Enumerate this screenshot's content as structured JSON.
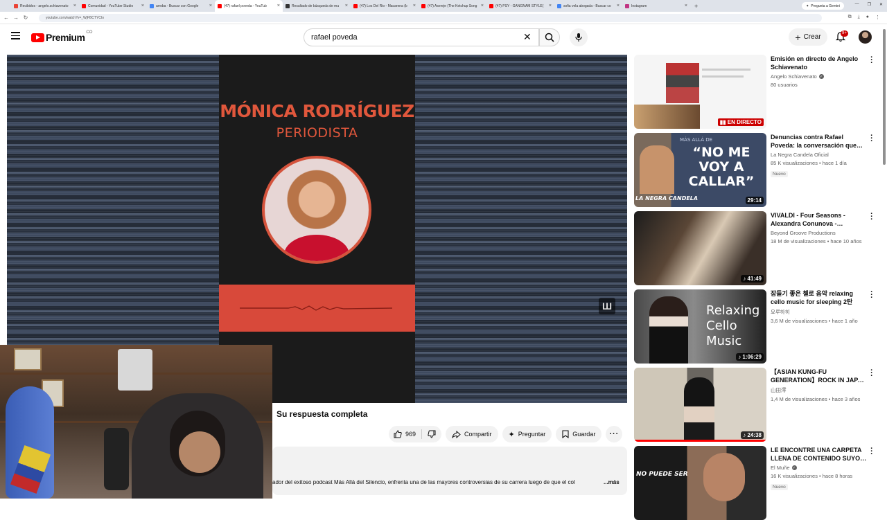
{
  "browser": {
    "tabs": [
      {
        "title": "Recibidos - angelo.schiavenato",
        "color": "#ea4335"
      },
      {
        "title": "Comunidad - YouTube Studio",
        "color": "#ff0000"
      },
      {
        "title": "arroba - Buscar con Google",
        "color": "#4285f4"
      },
      {
        "title": "(47) rafael poveda - YouTub",
        "color": "#ff0000",
        "active": true
      },
      {
        "title": "Resultado de búsqueda de mu",
        "color": "#333333"
      },
      {
        "title": "(47) Los Del Rio - Macarena (b",
        "color": "#ff0000"
      },
      {
        "title": "(47) Asereje (The Ketchup Song",
        "color": "#ff0000"
      },
      {
        "title": "(47) PSY - GANGNAM STYLE(",
        "color": "#ff0000"
      },
      {
        "title": "sofia vela abogada - Buscar co",
        "color": "#4285f4"
      },
      {
        "title": "Instagram",
        "color": "#c13584"
      }
    ],
    "gemini_label": "Pregunta a Gemini",
    "url": "youtube.com/watch?v=_WjFBCTYCIo"
  },
  "header": {
    "logo_text": "Premium",
    "country_code": "CO",
    "search_value": "rafael poveda",
    "create_label": "Crear",
    "notifications_count": "9+"
  },
  "video": {
    "card_name": "MÓNICA RODRÍGUEZ",
    "card_role": "PERIODISTA",
    "title": "Su respuesta completa",
    "likes": "969",
    "share_label": "Compartir",
    "ask_label": "Preguntar",
    "save_label": "Guardar",
    "description_snippet": "ador del exitoso podcast Más Allá del Silencio, enfrenta una de las mayores controversias de su carrera luego de que el col",
    "more_label": "...más"
  },
  "recommendations": [
    {
      "title": "Emisión en directo de Angelo Schiavenato",
      "channel": "Angelo Schiavenato",
      "verified": true,
      "meta": "80 usuarios",
      "live_label": "EN DIRECTO",
      "new": false,
      "duration": ""
    },
    {
      "title": "Denuncias contra Rafael Poveda: la conversación que encendió el ...",
      "channel": "La Negra Candela Oficial",
      "verified": false,
      "meta": "85 K visualizaciones • hace 1 día",
      "duration": "29:14",
      "new": true,
      "new_label": "Nuevo",
      "thumb_text": "“NO ME VOY A CALLAR”",
      "thumb_sub": "LA NEGRA CANDELA",
      "thumb_top": "MÁS ALLÁ DE"
    },
    {
      "title": "VIVALDI - Four Seasons - Alexandra Conunova - Orchestre ...",
      "channel": "Beyond Groove Productions",
      "verified": false,
      "meta": "18 M de visualizaciones • hace 10 años",
      "duration": "41:49",
      "new": false
    },
    {
      "title": "잠들기 좋은 첼로 음악 relaxing cello music for sleeping 2탄",
      "channel": "요루하히",
      "verified": false,
      "meta": "3,6 M de visualizaciones • hace 1 año",
      "duration": "1:06:29",
      "new": false,
      "thumb_text": "Relaxing Cello Music"
    },
    {
      "title": "【ASIAN KUNG-FU GENERATION】ROCK IN JAPAN ...",
      "channel": "山田澪",
      "verified": false,
      "meta": "1,4 M de visualizaciones • hace 3 años",
      "duration": "24:38",
      "new": false
    },
    {
      "title": "LE ENCONTRE UNA CARPETA LLENA DE CONTENIDO SUYO | ...",
      "channel": "El Muñe",
      "verified": true,
      "meta": "16 K visualizaciones • hace 8 horas",
      "duration": "",
      "new": true,
      "new_label": "Nuevo",
      "thumb_text": "NO PUEDE SER"
    }
  ],
  "colors": {
    "brand_red": "#ff0000",
    "card_accent": "#e0573c",
    "pill_bg": "#f2f2f2"
  }
}
